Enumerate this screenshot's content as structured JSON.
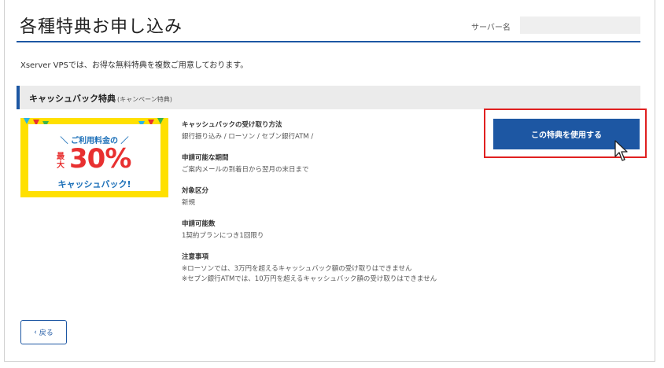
{
  "header": {
    "title": "各種特典お申し込み",
    "server_label": "サーバー名",
    "server_name": ""
  },
  "intro": "Xserver VPSでは、お得な無料特典を複数ご用意しております。",
  "section": {
    "title": "キャッシュバック特典",
    "subtitle": "(キャンペーン特典)"
  },
  "banner": {
    "line1": "＼ ご利用料金の ／",
    "prefix": "最大",
    "big": "30%",
    "bottom": "キャッシュバック!"
  },
  "details": [
    {
      "label": "キャッシュバックの受け取り方法",
      "value": "銀行振り込み / ローソン / セブン銀行ATM /"
    },
    {
      "label": "申請可能な期間",
      "value": "ご案内メールの到着日から翌月の末日まで"
    },
    {
      "label": "対象区分",
      "value": "新規"
    },
    {
      "label": "申請可能数",
      "value": "1契約プランにつき1回限り"
    },
    {
      "label": "注意事項",
      "value": "※ローソンでは、3万円を超えるキャッシュバック額の受け取りはできません",
      "value2": "※セブン銀行ATMでは、10万円を超えるキャッシュバック額の受け取りはできません"
    }
  ],
  "use_button_label": "この特典を使用する",
  "back_button": {
    "icon": "chevron-left-icon",
    "label": "戻る"
  },
  "colors": {
    "accent": "#1d57a3",
    "highlight": "#e02020",
    "banner_bg": "#ffe000",
    "banner_red": "#e83030"
  }
}
